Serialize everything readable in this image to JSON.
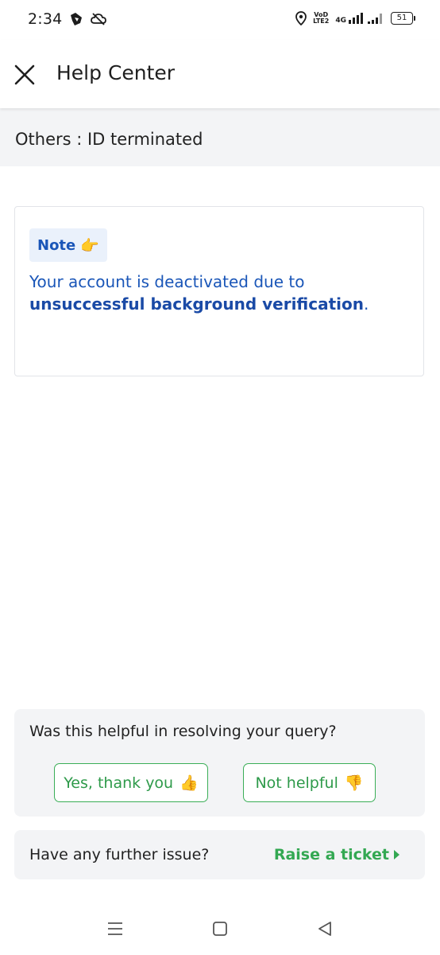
{
  "status_bar": {
    "time": "2:34",
    "volte_top": "VoD",
    "volte_bottom": "LTE2",
    "network": "4G",
    "battery": "51",
    "icons": [
      "messaging-app-icon",
      "cloud-off-icon",
      "location-icon",
      "signal-icon",
      "battery-icon"
    ]
  },
  "header": {
    "title": "Help Center",
    "close_icon": "close-icon"
  },
  "category": {
    "title": "Others : ID terminated"
  },
  "note": {
    "label": "Note",
    "emoji": "👉",
    "text_plain": "Your account is deactivated due to ",
    "text_bold": "unsuccessful background verification",
    "text_end": "."
  },
  "feedback": {
    "question": "Was this helpful in resolving your query?",
    "yes_label": "Yes, thank you",
    "yes_emoji": "👍",
    "no_label": "Not helpful",
    "no_emoji": "👎"
  },
  "ticket": {
    "question": "Have any further issue?",
    "action_label": "Raise a ticket"
  },
  "colors": {
    "accent_blue": "#1a56b8",
    "accent_green": "#33a852",
    "panel_gray": "#f3f4f6"
  },
  "nav": {
    "icons": [
      "menu-icon",
      "home-icon",
      "back-icon"
    ]
  }
}
